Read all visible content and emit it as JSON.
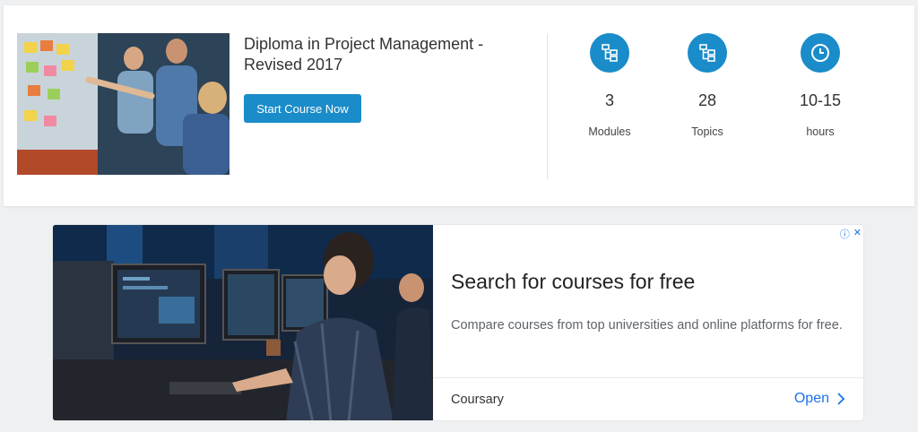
{
  "course": {
    "title": "Diploma in Project Management - Revised 2017",
    "start_button": "Start Course Now",
    "stats": [
      {
        "icon": "modules-icon",
        "value": "3",
        "label": "Modules"
      },
      {
        "icon": "topics-icon",
        "value": "28",
        "label": "Topics"
      },
      {
        "icon": "clock-icon",
        "value": "10-15",
        "label": "hours"
      }
    ]
  },
  "ad": {
    "headline": "Search for courses for free",
    "description": "Compare courses from top universities and online platforms for free.",
    "brand": "Coursary",
    "cta": "Open"
  },
  "colors": {
    "accent": "#1a8cc9",
    "link": "#1a73e8"
  }
}
